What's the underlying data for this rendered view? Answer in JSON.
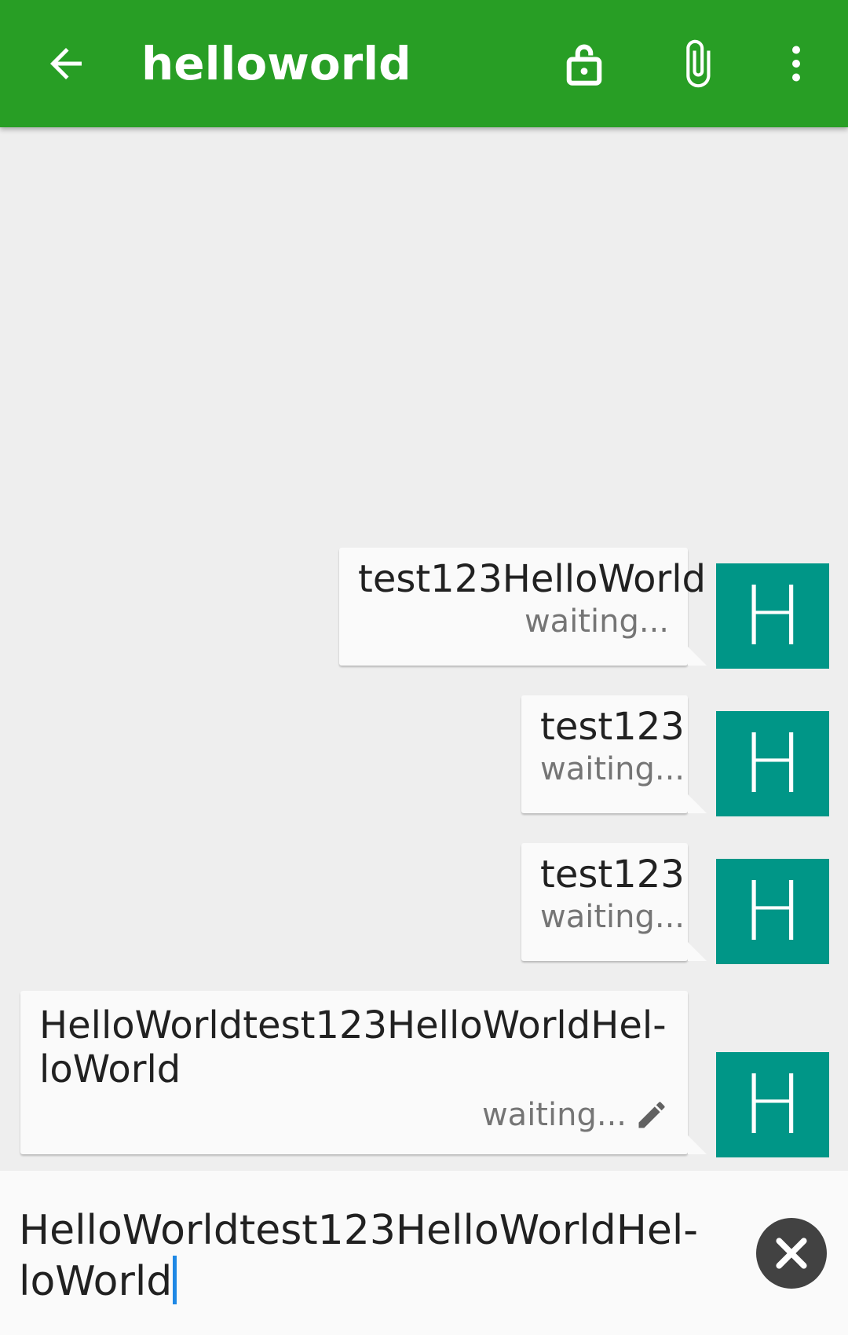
{
  "app_bar": {
    "title": "helloworld",
    "icons": [
      "arrow-back-icon",
      "lock-open-icon",
      "attach-icon",
      "more-vert-icon"
    ],
    "color": "#289e25"
  },
  "messages": [
    {
      "text": "test123HelloWorld",
      "status": "waiting...",
      "avatar": "H"
    },
    {
      "text": "test123",
      "status": "waiting...",
      "avatar": "H"
    },
    {
      "text": "test123",
      "status": "waiting...",
      "avatar": "H"
    },
    {
      "text_line1": "HelloWorldtest123HelloWorldHel-",
      "text_line2": "loWorld",
      "status": "waiting...",
      "avatar": "H",
      "status_icon": "edit-icon"
    }
  ],
  "composer": {
    "line1": "HelloWorldtest123HelloWorldHel-",
    "line2": "loWorld",
    "cancel_icon": "close-icon"
  },
  "colors": {
    "avatar": "#009687",
    "background": "#eeeeee",
    "bubble": "#fafafa",
    "caret": "#1e88e5"
  }
}
